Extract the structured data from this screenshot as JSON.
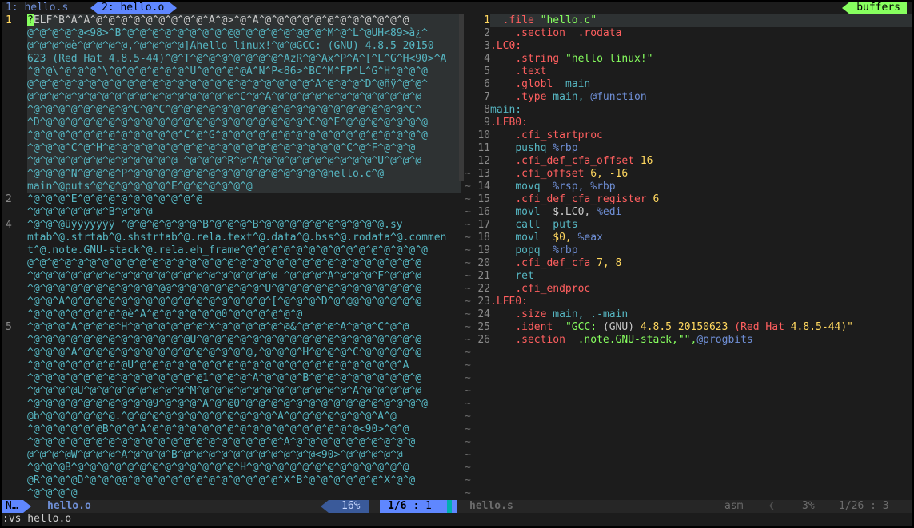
{
  "tabline": {
    "tab1": "1: hello.s",
    "tab2": "2: hello.o",
    "buffers_label": "buffers"
  },
  "left_pane": {
    "lines": [
      {
        "num": "1",
        "rows": [
          "?ELF^B^A^A^@^@^@^@^@^@^@^@^@^A^@>^@^A^@^@^@^@^@^@^@^@^@^@^@^@",
          "@^@^@^@^@<98>^B^@^@^@^@^@^@^@^@^@@^@^@^@^@^@@^@^M^@^L^@UH<89>å¿^",
          "@^@^@^@è^@^@^@^@,^@^@^@^@]Ãhello linux!^@^@GCC: (GNU) 4.8.5 20150",
          "623 (Red Hat 4.8.5-44)^@^T^@^@^@^@^@^@^@^AzR^@^Ax^P^A^[^L^G^H<90>^A",
          "^@^@\\^@^@^@^\\^@^@^@^@^@^@^U^@^@^@^@A^N^P<86>^BC^M^FP^L^G^H^@^@^@",
          "@^@^@^@^@^@^@^@^@^@^@^@^@^@^@^@^@^@^@^@^@^@^@^A^@^@^@^D^@ñÿ^@^@^",
          "@^@^@^@^@^@^@^@^@^@^@^@^@^@^@^@^@^C^@^A^@^@^@^@^@^@^@^@^@^@^@^@",
          "^@^@^@^@^@^@^@^@^C^@^C^@^@^@^@^@^@^@^@^@^@^@^@^@^@^@^@^@^@^@^C^",
          "^D^@^@^@^@^@^@^@^@^@^@^@^@^@^@^@^@^@^@^@^@^@^C^@^E^@^@^@^@^@^@^@",
          "^@^@^@^@^@^@^@^@^@^@^@^@^C^@^G^@^@^@^@^@^@^@^@^@^@^@^@^@^@^@^@^@",
          "^@^@^@^C^@^H^@^@^@^@^@^@^@^@^@^@^@^@^@^@^@^@^@^@^@^C^@^F^@^@^@",
          "^@^@^@^@^@^@^@^@^@^@^@^@ ^@^@^@^R^@^A^@^@^@^@^@^@^@^@^@^U^@^@^@",
          "^@^@^@^N^@^@^@^P^@^@^@^@^@^@^@^@^@^@^@^@^@^@^@^@hello.c^@",
          "main^@puts^@^@^@^@^@^@^E^@^@^@^@^@^@"
        ]
      },
      {
        "num": "2",
        "rows": [
          "^@^@^@^E^@^@^@^@^@^@^@^@^@^@",
          "^@^@^@^@^@^@^B^@^@^@"
        ]
      },
      {
        "num": "4",
        "rows": [
          "^@^@^@üÿÿÿÿÿÿÿ ^@^@^@^@^@^@^B^@^@^@^B^@^@^@^@^@^@^@^@^@^@.sy",
          "mtab^@.strtab^@.shstrtab^@.rela.text^@.data^@.bss^@.rodata^@.commen",
          "t^@.note.GNU-stack^@.rela.eh_frame^@^@^@^@^@^@^@^@^@^@^@^@^@^@^@",
          "@^@^@^@^@^@^@^@^@^@^@^@^@^@^@^@^@^@^@^@^@^@^@^@^@^@^@^@^@^@^@^@",
          "^@^@^@^@^@^@^@^@^@^@^@^@^@^@^@^@^@^@^@^@ ^@^@^@^A^@^@^@^F^@^@^@",
          "^@^@^@^@^@^@^@^@^@^@^@@^@^@^@^@^@^@^@^U^@^@^@^@^@^@^@^@^@^@^@^@",
          "^@^@^A^@^@^@^@^@^@^@^@^@^@^@^@^@^@^@^@^[^@^@^@^D^@^@@^@^@^@^@^@",
          "^@^@^@^@^@^@^@^@è^A^@^@^@^@^@^@0^@^@^@^@^@^@"
        ]
      },
      {
        "num": "5",
        "rows": [
          "^@^@^@^A^@^@^@^H^@^@^@^@^@^@^X^@^@^@^@^@^@&^@^@^@^A^@^@^C^@^@",
          "^@^@^@^@^@^@^@^@^@^@^@^@^@U^@^@^@^@^@^@^@^@^@^@^@^@^@^@^@^@^@^@",
          "^@^@^@^A^@^@^@^@^@^@^@^@^@^@^@^@^@^@,^@^@^@^H^@^@^@^C^@^@^@^@^@",
          "^@^@^@^@^@^@^@^@U^@^@^@^@^@^@^@^@^@^@^@^@^@^@^@^@^@^@^@^@^@^A",
          "^@^@^@^@^@^@^@^@^@^@^@^@^@^@1^@^@^@^A^@^@^@^B^@^@^@^@^@^@^@^@^@",
          "^@^@^@^@U^@^@^@^@^@^@^@^@^M^@^@^@^@^@^@^@^@^@^@^@^@^A^@^@^@^@^@",
          "^@^@^@^@^@^@^@^@^@^@9^@^@^@^A^@^@0^@^@^@^@^@^@^@^@^@^@^@^@^@^@^@",
          "@b^@^@^@^@^@^@.^@^@^@^@^@^@^@^@^@^@^@^@^A^@^@^@^@^@^@^@^A^@",
          "^@^@^@^@^@^@B^@^@^A^@^@^@^@^@^@^@^@^@^@^@^@^@^@^@^@^@<90>^@^@",
          "^@^@^@^@^@^@^@^@^@^@^@^@^@^@^@^@^@^@^@^@^A^@^@^@^@^@^@^@^@^@^@",
          "@^@^@^@W^@^@^@^A^@^@^@^B^@^@^@^@^@^@^@^@^@^@^@<90>^@^@^@^@^@",
          "^@^@^@B^@^@^@^@^@^@^@^@^@^@^@^@^@^H^@^@^@^@^@^@^@^@^@^@^@^@^@",
          "@R^@^@^@D^@^@^@@^@^@^@^@^@^@^@^@^@^@^@^@^X^B^@^@^@^@^@^@^X^@^@",
          "^@^@^@^@"
        ]
      }
    ]
  },
  "right_pane": {
    "lines": [
      {
        "num": "1"
      },
      {
        "num": "2"
      },
      {
        "num": "3"
      },
      {
        "num": "4"
      },
      {
        "num": "5"
      },
      {
        "num": "6"
      },
      {
        "num": "7"
      },
      {
        "num": "8"
      },
      {
        "num": "9"
      },
      {
        "num": "10"
      },
      {
        "num": "11"
      },
      {
        "num": "12"
      },
      {
        "num": "13"
      },
      {
        "num": "14"
      },
      {
        "num": "15"
      },
      {
        "num": "16"
      },
      {
        "num": "17"
      },
      {
        "num": "18"
      },
      {
        "num": "19"
      },
      {
        "num": "20"
      },
      {
        "num": "21"
      },
      {
        "num": "22"
      },
      {
        "num": "23"
      },
      {
        "num": "24"
      },
      {
        "num": "25"
      },
      {
        "num": "26"
      }
    ],
    "code": {
      "l1_dir": ".file",
      "l1_str": "\"hello.c\"",
      "l2_dir": ".section",
      "l2_arg": ".rodata",
      "l3_lbl": ".LC0:",
      "l4_dir": ".string",
      "l4_str": "\"hello linux!\"",
      "l5_dir": ".text",
      "l6_dir": ".globl",
      "l6_arg": "main",
      "l7_dir": ".type",
      "l7_arg": "main,",
      "l7_at": "@function",
      "l8_lbl": "main:",
      "l9_lbl": ".LFB0:",
      "l10_dir": ".cfi_startproc",
      "l11_op": "pushq",
      "l11_reg": "%rbp",
      "l12_dir": ".cfi_def_cfa_offset",
      "l12_num": "16",
      "l13_dir": ".cfi_offset",
      "l13_n1": "6,",
      "l13_n2": "-16",
      "l14_op": "movq",
      "l14_r1": "%rsp,",
      "l14_r2": "%rbp",
      "l15_dir": ".cfi_def_cfa_register",
      "l15_num": "6",
      "l16_op": "movl",
      "l16_arg": "$.LC0,",
      "l16_reg": "%edi",
      "l17_op": "call",
      "l17_arg": "puts",
      "l18_op": "movl",
      "l18_num": "$0,",
      "l18_reg": "%eax",
      "l19_op": "popq",
      "l19_reg": "%rbp",
      "l20_dir": ".cfi_def_cfa",
      "l20_num": "7, 8",
      "l21_op": "ret",
      "l22_dir": ".cfi_endproc",
      "l23_lbl": ".LFE0:",
      "l24_dir": ".size",
      "l24_arg": "main, .-main",
      "l25_dir": ".ident",
      "l25_q": "\"GCC:",
      "l25_p": "(GNU)",
      "l25_v": "4.8.5 20150623",
      "l25_rh": "(Red Hat",
      "l25_v2": "4.8.5-44)\"",
      "l26_dir": ".section",
      "l26_arg": ".note.GNU-stack,\"\",",
      "l26_at": "@progbits"
    }
  },
  "statusline": {
    "mode": "N…",
    "left_file": "hello.o",
    "left_percent": "16%",
    "left_pos_line": "1/6",
    "left_pos_col": ":  1",
    "right_file": "hello.s",
    "right_filetype": "asm",
    "right_percent": "3%",
    "right_pos": "1/26 :  3"
  },
  "cmdline": ":vs hello.o",
  "colors": {
    "background": "#1c1c1c",
    "accent": "#5f87ff",
    "buffers": "#87ff5f",
    "hex_text": "#56b6c2"
  }
}
